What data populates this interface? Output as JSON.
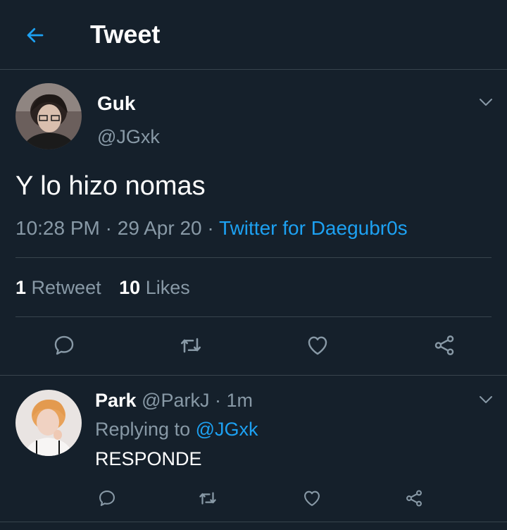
{
  "header": {
    "title": "Tweet",
    "back_icon": "arrow-left-icon",
    "accent": "#1da1f2"
  },
  "tweet": {
    "author_name": "Guk",
    "author_handle": "@JGxk",
    "text": "Y lo hizo nomas",
    "time": "10:28 PM",
    "sep1": " · ",
    "date": "29 Apr 20",
    "sep2": " · ",
    "source": "Twitter for Daegubr0s",
    "retweets_count": "1",
    "retweets_label": "Retweet",
    "likes_count": "10",
    "likes_label": "Likes",
    "actions": [
      "reply-icon",
      "retweet-icon",
      "like-icon",
      "share-icon"
    ]
  },
  "reply": {
    "author_name": "Park",
    "author_handle": "@ParkJ",
    "age_sep": " · ",
    "age": "1m",
    "replying_label": "Replying to",
    "replying_to": "@JGxk",
    "text": "RESPONDE",
    "actions": [
      "reply-icon",
      "retweet-icon",
      "like-icon",
      "share-icon"
    ]
  },
  "colors": {
    "background": "#15202b",
    "muted": "#8899a6",
    "divider": "#38444d",
    "link": "#1da1f2"
  }
}
